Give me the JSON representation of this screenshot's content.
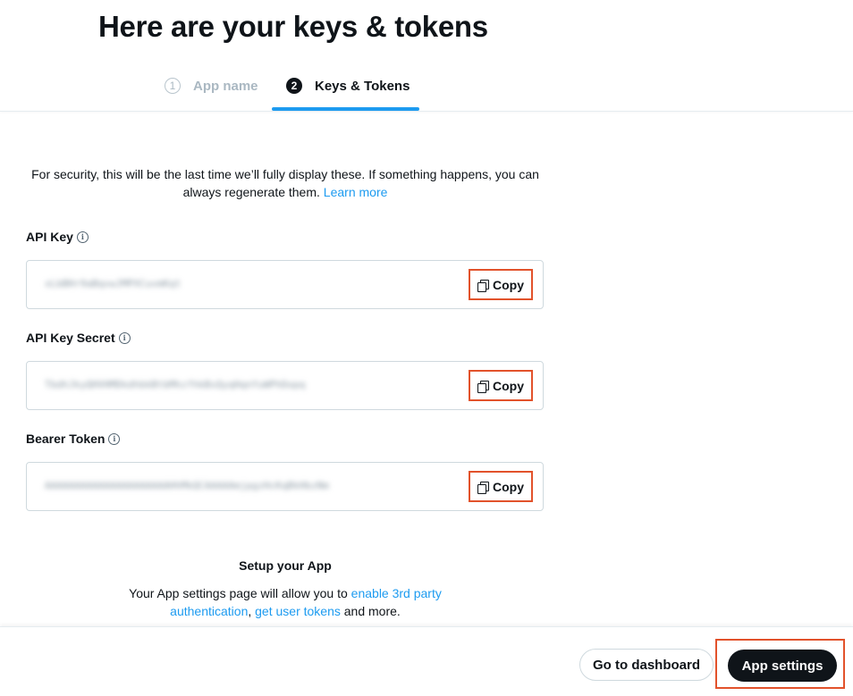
{
  "header": {
    "title": "Here are your keys & tokens",
    "steps": [
      {
        "number": "1",
        "label": "App name",
        "state": "inactive"
      },
      {
        "number": "2",
        "label": "Keys & Tokens",
        "state": "active"
      }
    ]
  },
  "notice": {
    "text": "For security, this will be the last time we’ll fully display these. If something happens, you can always regenerate them. ",
    "link": "Learn more"
  },
  "keys": [
    {
      "label": "API Key",
      "value": "xLbBHr9aBqvwJMPXCuvmKqt",
      "copy_label": "Copy"
    },
    {
      "label": "API Key Secret",
      "value": "TbdhJkyQHVHMDkdhbkBtbMhzfhkBsQyqHqnYuWPhDopq",
      "copy_label": "Copy"
    },
    {
      "label": "Bearer Token",
      "value": "AAAAAAAAAAAAAAAAAAAAAHhMkQCAAAAAmjpgzHcKqBkHbzNm",
      "copy_label": "Copy"
    }
  ],
  "setup": {
    "title": "Setup your App",
    "text_before": "Your App settings page will allow you to ",
    "link1": "enable 3rd party authentication",
    "separator": ", ",
    "link2": "get user tokens",
    "text_after": " and more."
  },
  "footer": {
    "dashboard_label": "Go to dashboard",
    "settings_label": "App settings"
  },
  "colors": {
    "accent": "#1d9bf0",
    "highlight": "#e2522b",
    "dark": "#0f1419"
  }
}
